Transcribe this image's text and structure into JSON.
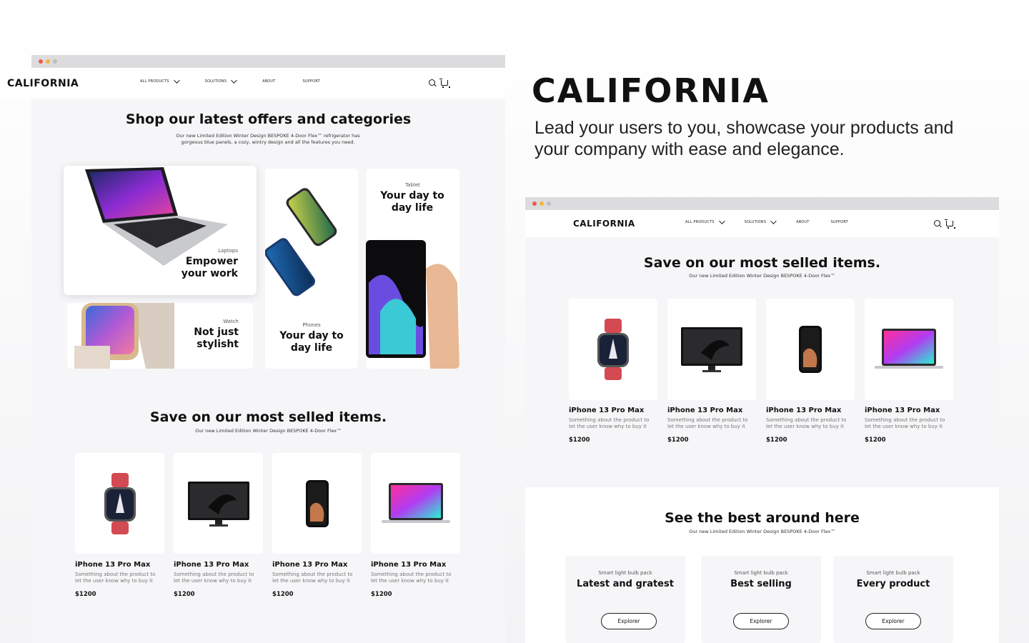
{
  "brand": "CALIFORNIA",
  "tagline": "Lead your users to you, showcase your products and your company with ease and elegance.",
  "colors": {
    "dot_red": "#ee5a4e",
    "dot_yellow": "#f2b63a",
    "dot_gray": "#bdbdbd",
    "accent_dark": "#111111"
  },
  "nav": {
    "logo": "CALIFORNIA",
    "links": [
      "ALL PRODUCTS",
      "SOLUTIONS",
      "ABOUT",
      "SUPPORT"
    ],
    "icons": [
      "search-icon",
      "cart-icon"
    ]
  },
  "left": {
    "offers": {
      "title": "Shop our latest offers and categories",
      "subtitle": "Our new Limited Edition Winter Design BESPOKE 4-Door Flex™ refrigerator has gorgeous blue panels, a cozy, wintry design and all the features you need."
    },
    "categories": [
      {
        "small": "Laptops",
        "big": "Empower your work"
      },
      {
        "small": "Phones",
        "big": "Your day to day life"
      },
      {
        "small": "Tablet",
        "big": "Your day to day life"
      },
      {
        "small": "Watch",
        "big": "Not just stylisht"
      }
    ],
    "selled": {
      "title": "Save on our most selled items.",
      "subtitle": "Our new Limited Edition Winter Design BESPOKE 4-Door Flex™"
    },
    "products": [
      {
        "name": "iPhone 13 Pro Max",
        "desc": "Something about the product to let the user know why to buy it",
        "price": "$1200",
        "icon": "watch-icon"
      },
      {
        "name": "iPhone 13 Pro Max",
        "desc": "Something about the product to let the user know why to buy it",
        "price": "$1200",
        "icon": "monitor-icon"
      },
      {
        "name": "iPhone 13 Pro Max",
        "desc": "Something about the product to let the user know why to buy it",
        "price": "$1200",
        "icon": "phone-icon"
      },
      {
        "name": "iPhone 13 Pro Max",
        "desc": "Something about the product to let the user know why to buy it",
        "price": "$1200",
        "icon": "laptop-icon"
      }
    ]
  },
  "right": {
    "selled": {
      "title": "Save on our most selled items.",
      "subtitle": "Our new Limited Edition Winter Design BESPOKE 4-Door Flex™"
    },
    "products": [
      {
        "name": "iPhone 13 Pro Max",
        "desc": "Something about the product to let the user know why to buy it",
        "price": "$1200"
      },
      {
        "name": "iPhone 13 Pro Max",
        "desc": "Something about the product to let the user know why to buy it",
        "price": "$1200"
      },
      {
        "name": "iPhone 13 Pro Max",
        "desc": "Something about the product to let the user know why to buy it",
        "price": "$1200"
      },
      {
        "name": "iPhone 13 Pro Max",
        "desc": "Something about the product to let the user know why to buy it",
        "price": "$1200"
      }
    ],
    "best": {
      "title": "See the best around here",
      "subtitle": "Our new Limited Edition Winter Design BESPOKE 4-Door Flex™"
    },
    "bulbs": [
      {
        "small": "Smart light bulb pack",
        "big": "Latest and gratest",
        "button": "Explorer"
      },
      {
        "small": "Smart light bulb pack",
        "big": "Best selling",
        "button": "Explorer"
      },
      {
        "small": "Smart light bulb pack",
        "big": "Every product",
        "button": "Explorer"
      }
    ]
  }
}
